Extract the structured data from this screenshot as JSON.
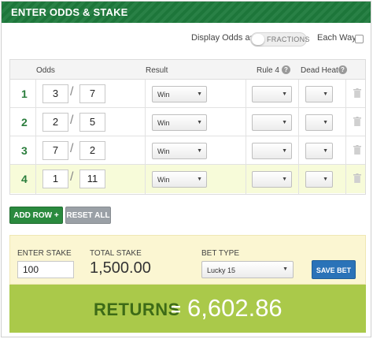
{
  "header": {
    "title": "ENTER ODDS & STAKE"
  },
  "options": {
    "display_odds_label": "Display Odds as",
    "odds_format": "FRACTIONS",
    "each_way_label": "Each Way",
    "each_way_checked": false
  },
  "table": {
    "headers": {
      "odds": "Odds",
      "result": "Result",
      "rule4": "Rule 4",
      "dead_heat": "Dead Heat"
    },
    "rows": [
      {
        "num": "1",
        "num_odds": "3",
        "den_odds": "7",
        "result": "Win",
        "rule4": "",
        "dead_heat": ""
      },
      {
        "num": "2",
        "num_odds": "2",
        "den_odds": "5",
        "result": "Win",
        "rule4": "",
        "dead_heat": ""
      },
      {
        "num": "3",
        "num_odds": "7",
        "den_odds": "2",
        "result": "Win",
        "rule4": "",
        "dead_heat": ""
      },
      {
        "num": "4",
        "num_odds": "1",
        "den_odds": "11",
        "result": "Win",
        "rule4": "",
        "dead_heat": ""
      }
    ]
  },
  "buttons": {
    "add_row": "ADD ROW",
    "reset_all": "RESET ALL",
    "save_bet": "SAVE BET"
  },
  "stake": {
    "enter_stake_label": "ENTER STAKE",
    "stake_value": "100",
    "total_stake_label": "TOTAL STAKE",
    "total_stake_value": "1,500.00",
    "bet_type_label": "BET TYPE",
    "bet_type_value": "Lucky 15"
  },
  "returns": {
    "label": "RETURNS",
    "equals": "=",
    "value": "6,602.86"
  },
  "colors": {
    "brand_green": "#1e7a3c",
    "returns_bg": "#aac94a",
    "save_blue": "#2a73b8",
    "highlight_row": "#f7fbd9"
  }
}
